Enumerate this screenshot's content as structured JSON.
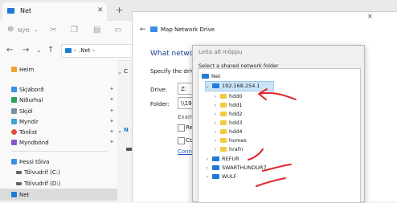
{
  "explorer": {
    "tab_title": "Net",
    "new_button": "Nýtt",
    "breadcrumb": ".Net",
    "nav": [
      {
        "label": "Heim"
      },
      {
        "label": "Skjáborð"
      },
      {
        "label": "Niðurhal"
      },
      {
        "label": "Skjöl"
      },
      {
        "label": "Myndir"
      },
      {
        "label": "Tónlist"
      },
      {
        "label": "Myndbönd"
      },
      {
        "label": "Þessi tölva"
      },
      {
        "label": "Tölvudrif (C:)"
      },
      {
        "label": "Tölvudrif (D:)"
      },
      {
        "label": "Net"
      }
    ],
    "partial_c": "C"
  },
  "map_dialog": {
    "title": "Map Network Drive",
    "heading": "What network",
    "instruction": "Specify the drive l",
    "drive_label": "Drive:",
    "drive_value": "Z:",
    "folder_label": "Folder:",
    "folder_value": "\\\\19",
    "example_partial": "Exam",
    "reconnect_partial": "Re",
    "connect_partial": "Co",
    "link_partial": "Conne"
  },
  "browse_dialog": {
    "title": "Leita að möppu",
    "prompt": "Select a shared network folder",
    "tree": [
      {
        "label": "Net"
      },
      {
        "label": "192.168.254.1"
      },
      {
        "label": "hdd0"
      },
      {
        "label": "hdd1"
      },
      {
        "label": "hdd2"
      },
      {
        "label": "hdd3"
      },
      {
        "label": "hdd4"
      },
      {
        "label": "homes"
      },
      {
        "label": "hrafn"
      },
      {
        "label": "REFUR"
      },
      {
        "label": "SWARTHUNDUR7"
      },
      {
        "label": "WULF"
      }
    ]
  },
  "colors": {
    "accent": "#1f7bd6",
    "folder": "#f5c842",
    "annotation": "#e0262b"
  }
}
